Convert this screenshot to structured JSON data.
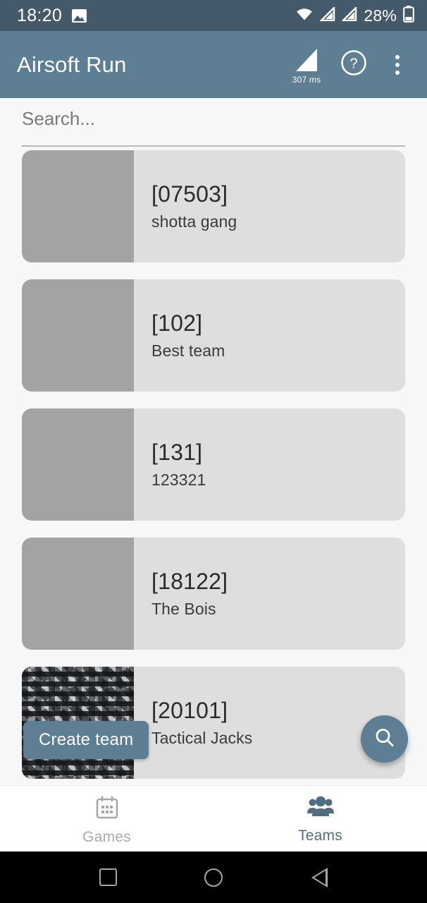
{
  "status_bar": {
    "time": "18:20",
    "battery_percent": "28%",
    "photo_icon": "photo-icon",
    "wifi_icon": "wifi-icon",
    "signal_icon_1": "cellular-signal-icon",
    "signal_icon_2": "cellular-signal-icon",
    "battery_icon": "battery-icon",
    "background_color": "#44596a"
  },
  "app_bar": {
    "title": "Airsoft Run",
    "ping_label": "307 ms",
    "ping_icon": "signal-strength-icon",
    "help_icon": "help-circle-icon",
    "overflow_icon": "more-vertical-icon",
    "background_color": "#5d7e93"
  },
  "search": {
    "placeholder": "Search...",
    "value": ""
  },
  "teams": [
    {
      "code": "[07503]",
      "name": "shotta gang",
      "thumb": "plain"
    },
    {
      "code": "[102]",
      "name": "Best team",
      "thumb": "plain"
    },
    {
      "code": "[131]",
      "name": "123321",
      "thumb": "plain"
    },
    {
      "code": "[18122]",
      "name": "The Bois",
      "thumb": "plain"
    },
    {
      "code": "[20101]",
      "name": "Tactical Jacks",
      "thumb": "camo"
    }
  ],
  "tooltip": {
    "label": "Create team",
    "color": "#5d7e93"
  },
  "fab": {
    "icon": "search-icon",
    "color": "#5d7e93"
  },
  "bottom_nav": {
    "items": [
      {
        "label": "Games",
        "icon": "calendar-icon",
        "active": false,
        "color": "#a8a8a8"
      },
      {
        "label": "Teams",
        "icon": "people-group-icon",
        "active": true,
        "color": "#516e80"
      }
    ]
  },
  "android_nav": {
    "recents_icon": "square-recents-icon",
    "home_icon": "circle-home-icon",
    "back_icon": "triangle-back-icon"
  }
}
